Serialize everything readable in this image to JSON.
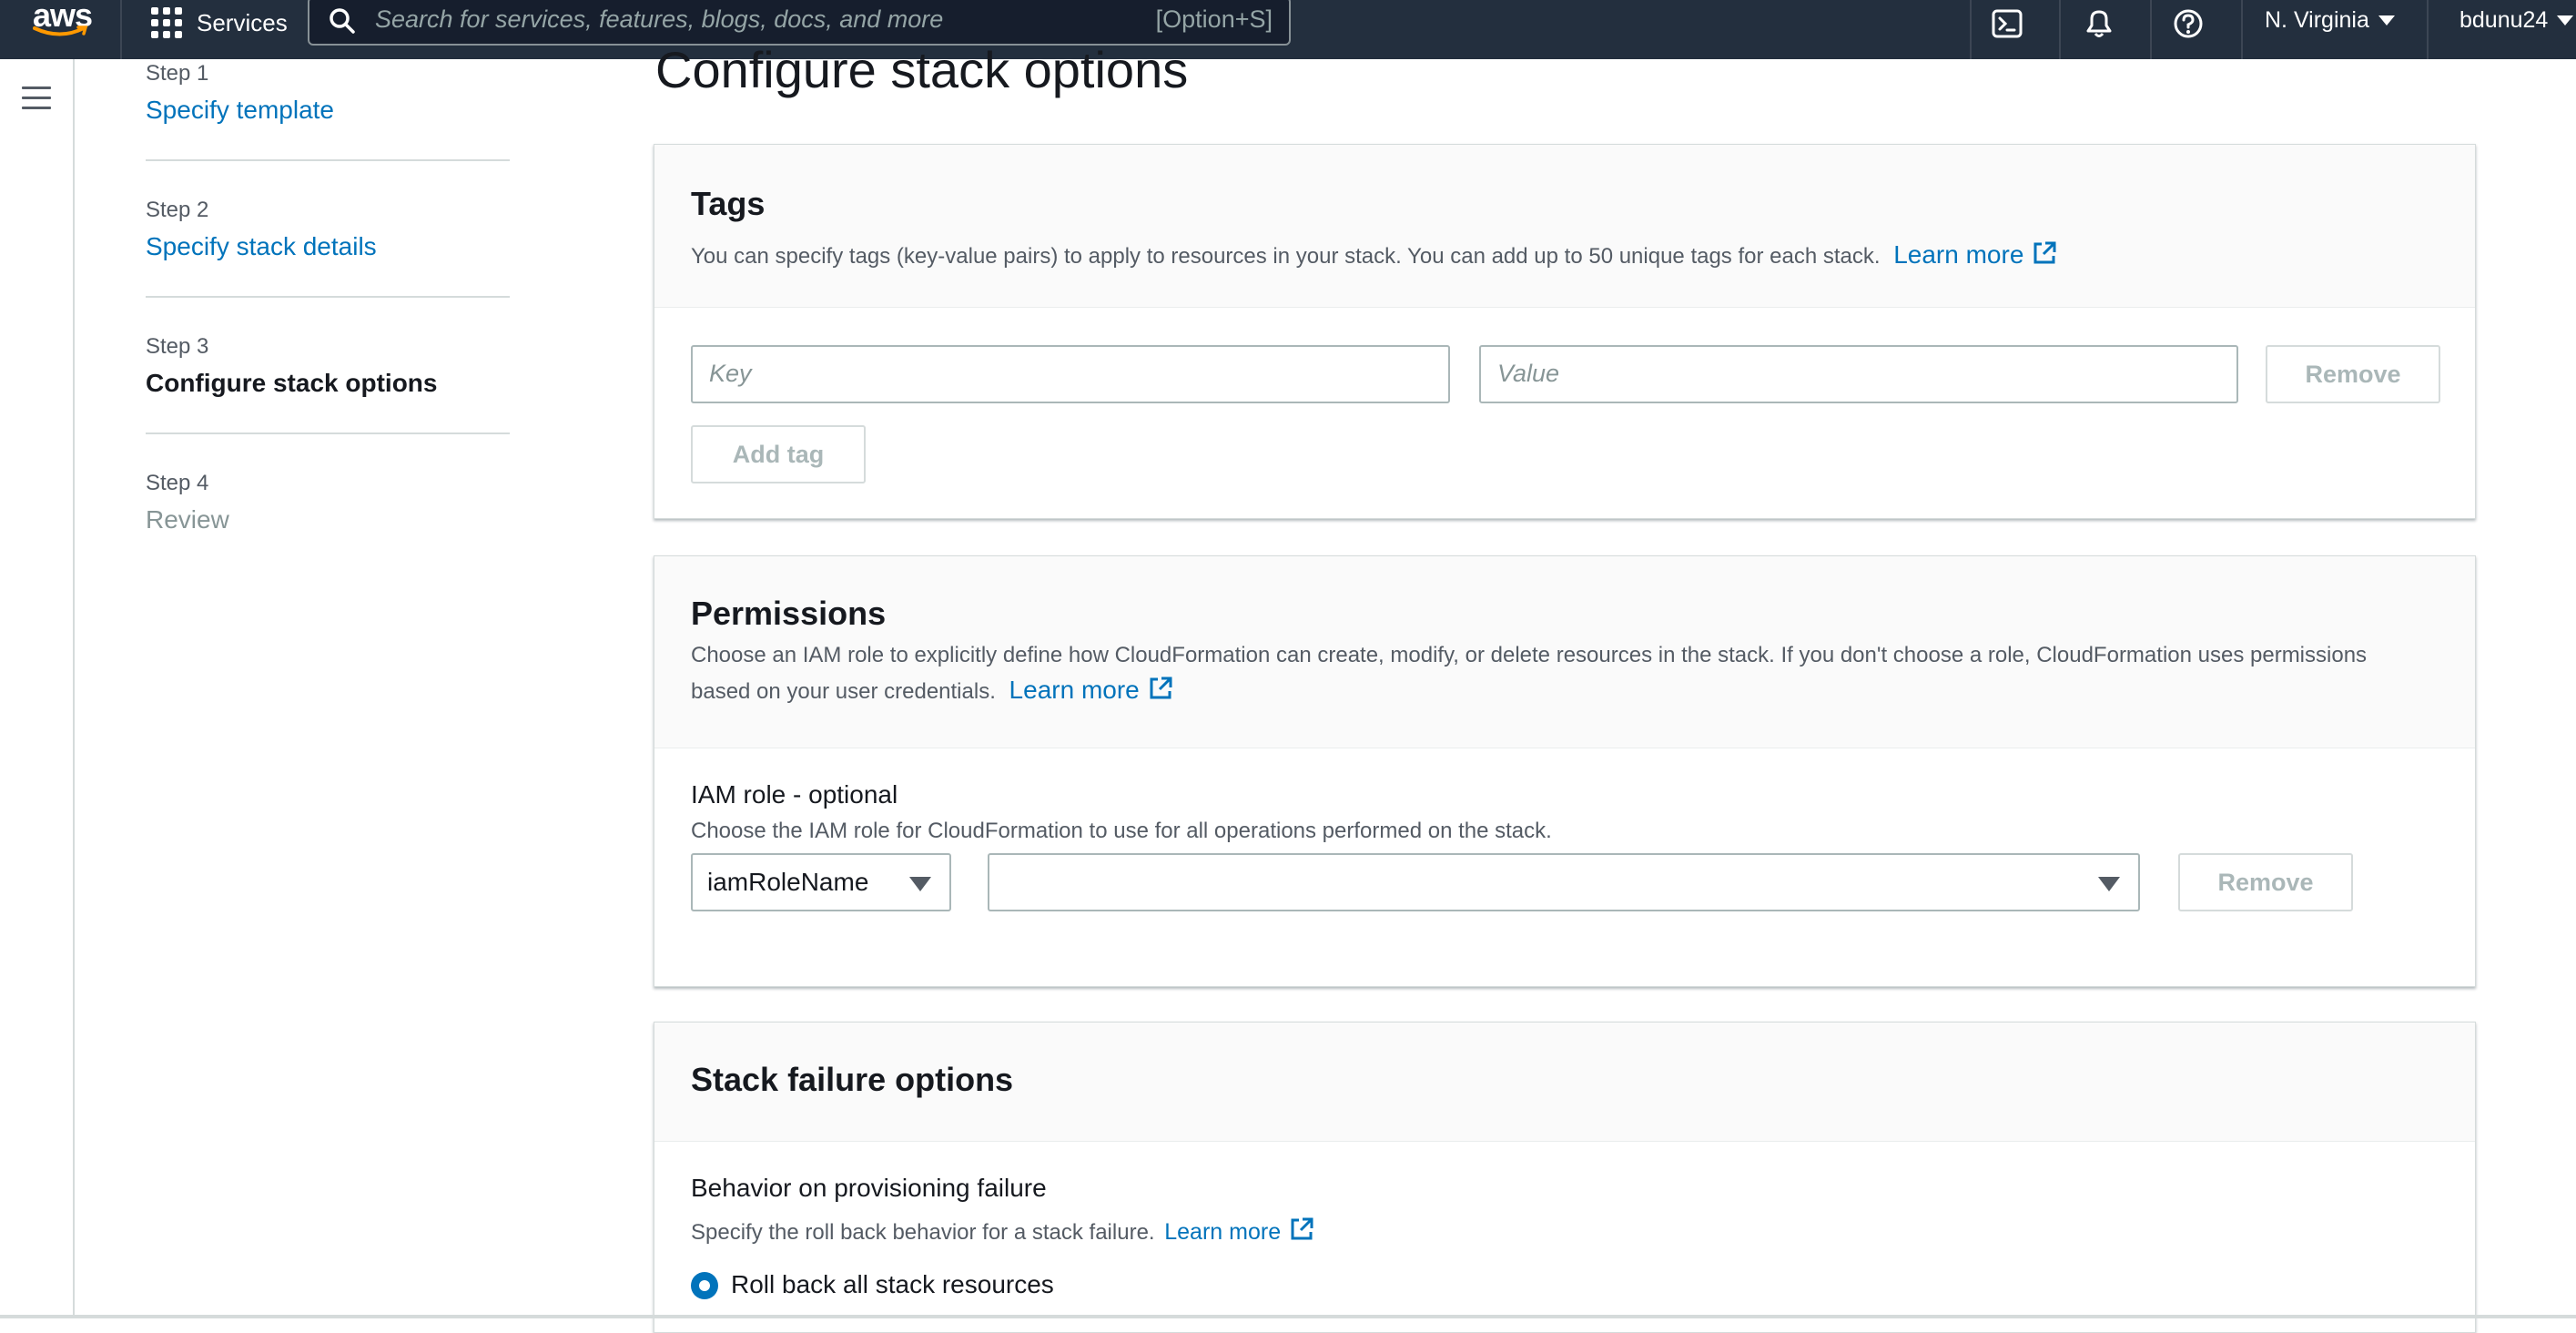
{
  "topnav": {
    "logo_text": "aws",
    "services_label": "Services",
    "search_placeholder": "Search for services, features, blogs, docs, and more",
    "search_shortcut": "[Option+S]",
    "region": "N. Virginia",
    "user": "bdunu24"
  },
  "steps": [
    {
      "num": "Step 1",
      "title": "Specify template"
    },
    {
      "num": "Step 2",
      "title": "Specify stack details"
    },
    {
      "num": "Step 3",
      "title": "Configure stack options"
    },
    {
      "num": "Step 4",
      "title": "Review"
    }
  ],
  "page_title": "Configure stack options",
  "tags": {
    "title": "Tags",
    "description": "You can specify tags (key-value pairs) to apply to resources in your stack. You can add up to 50 unique tags for each stack.",
    "learn_more": "Learn more",
    "key_placeholder": "Key",
    "value_placeholder": "Value",
    "remove_label": "Remove",
    "add_tag_label": "Add tag"
  },
  "permissions": {
    "title": "Permissions",
    "description_line1": "Choose an IAM role to explicitly define how CloudFormation can create, modify, or delete resources in the stack. If you don't choose a role, CloudFormation uses permissions",
    "description_line2": "based on your user credentials.",
    "learn_more": "Learn more",
    "iam_label": "IAM role - optional",
    "iam_desc": "Choose the IAM role for CloudFormation to use for all operations performed on the stack.",
    "iam_type_value": "iamRoleName",
    "role_value": "",
    "remove_label": "Remove"
  },
  "failure": {
    "title": "Stack failure options",
    "behavior_label": "Behavior on provisioning failure",
    "behavior_desc": "Specify the roll back behavior for a stack failure.",
    "learn_more": "Learn more",
    "option_rollback": "Roll back all stack resources"
  }
}
